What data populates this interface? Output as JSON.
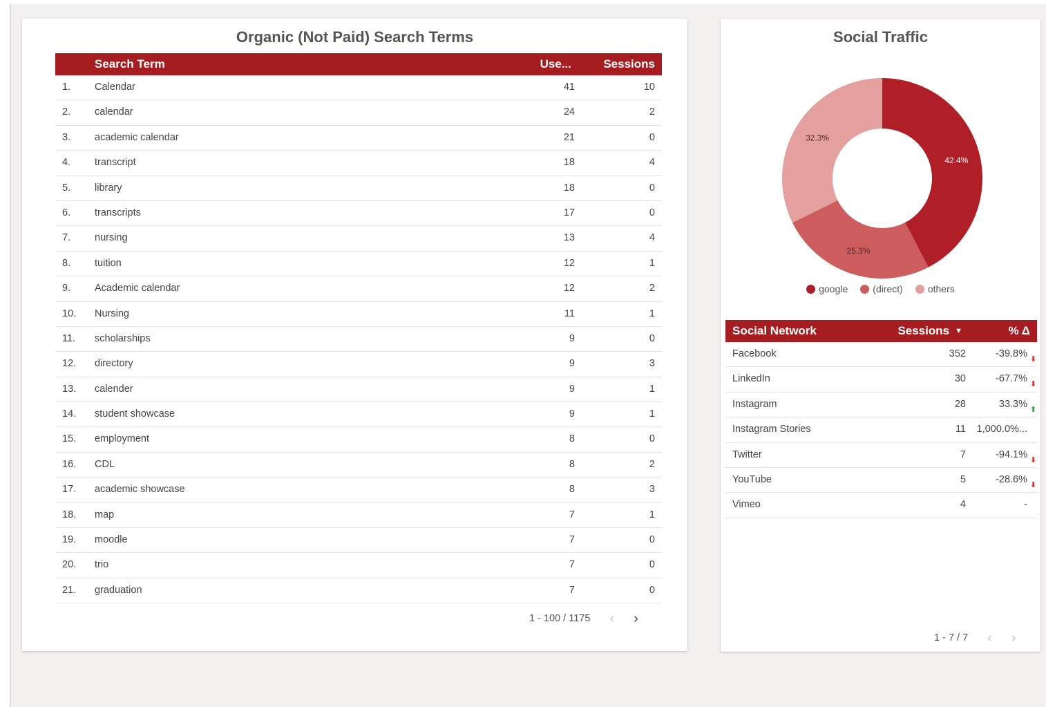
{
  "search_terms": {
    "title": "Organic (Not Paid) Search Terms",
    "columns": {
      "term": "Search Term",
      "users": "Use...",
      "sessions": "Sessions"
    },
    "rows": [
      {
        "n": "1.",
        "term": "Calendar",
        "users": "41",
        "sessions": "10"
      },
      {
        "n": "2.",
        "term": "calendar",
        "users": "24",
        "sessions": "2"
      },
      {
        "n": "3.",
        "term": "academic calendar",
        "users": "21",
        "sessions": "0"
      },
      {
        "n": "4.",
        "term": "transcript",
        "users": "18",
        "sessions": "4"
      },
      {
        "n": "5.",
        "term": "library",
        "users": "18",
        "sessions": "0"
      },
      {
        "n": "6.",
        "term": "transcripts",
        "users": "17",
        "sessions": "0"
      },
      {
        "n": "7.",
        "term": "nursing",
        "users": "13",
        "sessions": "4"
      },
      {
        "n": "8.",
        "term": "tuition",
        "users": "12",
        "sessions": "1"
      },
      {
        "n": "9.",
        "term": "Academic calendar",
        "users": "12",
        "sessions": "2"
      },
      {
        "n": "10.",
        "term": "Nursing",
        "users": "11",
        "sessions": "1"
      },
      {
        "n": "11.",
        "term": "scholarships",
        "users": "9",
        "sessions": "0"
      },
      {
        "n": "12.",
        "term": "directory",
        "users": "9",
        "sessions": "3"
      },
      {
        "n": "13.",
        "term": "calender",
        "users": "9",
        "sessions": "1"
      },
      {
        "n": "14.",
        "term": "student showcase",
        "users": "9",
        "sessions": "1"
      },
      {
        "n": "15.",
        "term": "employment",
        "users": "8",
        "sessions": "0"
      },
      {
        "n": "16.",
        "term": "CDL",
        "users": "8",
        "sessions": "2"
      },
      {
        "n": "17.",
        "term": "academic showcase",
        "users": "8",
        "sessions": "3"
      },
      {
        "n": "18.",
        "term": "map",
        "users": "7",
        "sessions": "1"
      },
      {
        "n": "19.",
        "term": "moodle",
        "users": "7",
        "sessions": "0"
      },
      {
        "n": "20.",
        "term": "trio",
        "users": "7",
        "sessions": "0"
      },
      {
        "n": "21.",
        "term": "graduation",
        "users": "7",
        "sessions": "0"
      }
    ],
    "pager": {
      "range": "1 - 100 / 1175",
      "prev": "‹",
      "next": "›"
    }
  },
  "social": {
    "title": "Social Traffic",
    "columns": {
      "network": "Social Network",
      "sessions": "Sessions",
      "sort_indicator": "▼",
      "pct": "% Δ"
    },
    "rows": [
      {
        "network": "Facebook",
        "sessions": "352",
        "pct": "-39.8%",
        "trend": "down"
      },
      {
        "network": "LinkedIn",
        "sessions": "30",
        "pct": "-67.7%",
        "trend": "down"
      },
      {
        "network": "Instagram",
        "sessions": "28",
        "pct": "33.3%",
        "trend": "up"
      },
      {
        "network": "Instagram Stories",
        "sessions": "11",
        "pct": "1,000.0%...",
        "trend": "none"
      },
      {
        "network": "Twitter",
        "sessions": "7",
        "pct": "-94.1%",
        "trend": "down"
      },
      {
        "network": "YouTube",
        "sessions": "5",
        "pct": "-28.6%",
        "trend": "down"
      },
      {
        "network": "Vimeo",
        "sessions": "4",
        "pct": "-",
        "trend": "none"
      }
    ],
    "pager": {
      "range": "1 - 7 / 7",
      "prev": "‹",
      "next": "›"
    }
  },
  "chart_data": {
    "type": "pie",
    "categories": [
      "google",
      "(direct)",
      "others"
    ],
    "values": [
      42.4,
      25.3,
      32.3
    ],
    "labels": [
      "42.4%",
      "25.3%",
      "32.3%"
    ],
    "colors": [
      "#b01f27",
      "#cc5c5e",
      "#e3a09f"
    ],
    "legend": "bottom"
  }
}
